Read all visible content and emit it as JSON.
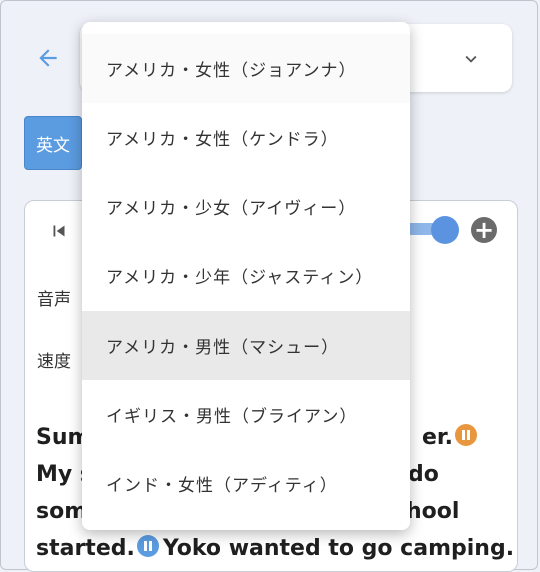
{
  "header": {
    "back_icon": "arrow-left-icon",
    "dropdown_icon": "chevron-down-icon"
  },
  "language_button": {
    "label": "英文"
  },
  "player": {
    "skip_icon": "skip-previous-icon",
    "add_icon": "plus-circle-icon",
    "voice_label": "音声",
    "speed_label": "速度"
  },
  "passage": {
    "line1_start": "Sum",
    "line1_end": "er.",
    "line2_start": "My s",
    "line2_end": "do",
    "line3_start": "som",
    "line3_end": "hool",
    "line4_start": "started.",
    "line4_end": "Yoko wanted to go camping."
  },
  "voice_options": [
    {
      "label": "アメリカ・女性（ジョアンナ）"
    },
    {
      "label": "アメリカ・女性（ケンドラ）"
    },
    {
      "label": "アメリカ・少女（アイヴィー）"
    },
    {
      "label": "アメリカ・少年（ジャスティン）"
    },
    {
      "label": "アメリカ・男性（マシュー）"
    },
    {
      "label": "イギリス・男性（ブライアン）"
    },
    {
      "label": "インド・女性（アディティ）"
    }
  ],
  "selected_voice": "アメリカ・男性（マシュー）",
  "colors": {
    "accent": "#5b9be0",
    "pause_orange": "#e8973f",
    "selected_bg": "#e9e9e9"
  }
}
